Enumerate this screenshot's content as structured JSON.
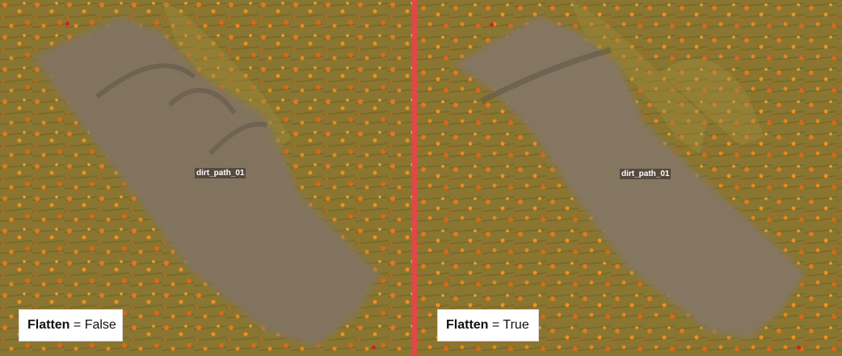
{
  "panels": [
    {
      "object_label": "dirt_path_01",
      "caption": {
        "property": "Flatten",
        "operator": "=",
        "value": "False"
      }
    },
    {
      "object_label": "dirt_path_01",
      "caption": {
        "property": "Flatten",
        "operator": "=",
        "value": "True"
      }
    }
  ],
  "colors": {
    "divider": "#e04848",
    "grass": "#8c7a32",
    "flowers": "#e0781e",
    "dirt": "#8a7a62",
    "marker": "#d81e1e"
  },
  "icons": [
    "control-point-marker"
  ]
}
